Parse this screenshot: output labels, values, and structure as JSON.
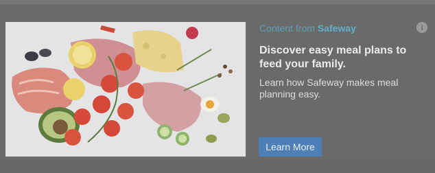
{
  "ad": {
    "sponsor_prefix": "Content from",
    "sponsor_brand": "Safeway",
    "headline": "Discover easy meal plans to feed your family.",
    "body": "Learn how Safeway makes meal planning easy.",
    "cta_label": "Learn More",
    "info_icon": "i",
    "image_subject": "watercolor food illustration",
    "colors": {
      "sponsor_text": "#5aa0b8",
      "cta_background": "#4d7fb6",
      "ad_background": "#6a6a6a"
    }
  }
}
